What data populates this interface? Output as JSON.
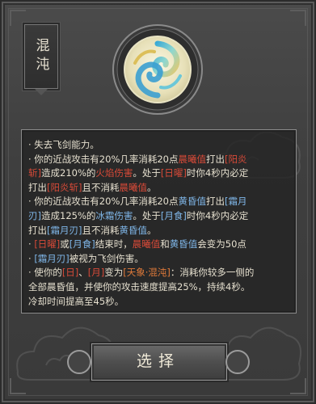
{
  "skill": {
    "name": "混沌",
    "lines": [
      {
        "parts": [
          {
            "t": "· 失去飞剑能力。",
            "c": ""
          }
        ]
      },
      {
        "parts": [
          {
            "t": "· 你的近战攻击有20%几率消耗20点",
            "c": ""
          },
          {
            "t": "晨曦值",
            "c": "r"
          },
          {
            "t": "打出",
            "c": ""
          },
          {
            "t": "[阳炎",
            "c": "r"
          }
        ]
      },
      {
        "parts": [
          {
            "t": "斩]",
            "c": "r"
          },
          {
            "t": "造成210%的",
            "c": ""
          },
          {
            "t": "火焰伤害",
            "c": "r"
          },
          {
            "t": "。处于",
            "c": ""
          },
          {
            "t": "[日曜]",
            "c": "r"
          },
          {
            "t": "时你4秒内必定",
            "c": ""
          }
        ]
      },
      {
        "parts": [
          {
            "t": "打出",
            "c": ""
          },
          {
            "t": "[阳炎斩]",
            "c": "r"
          },
          {
            "t": "且不消耗",
            "c": ""
          },
          {
            "t": "晨曦值",
            "c": "r"
          },
          {
            "t": "。",
            "c": ""
          }
        ]
      },
      {
        "parts": [
          {
            "t": "· 你的近战攻击有20%几率消耗20点",
            "c": ""
          },
          {
            "t": "黄昏值",
            "c": "b"
          },
          {
            "t": "打出",
            "c": ""
          },
          {
            "t": "[霜月",
            "c": "b"
          }
        ]
      },
      {
        "parts": [
          {
            "t": "刃]",
            "c": "b"
          },
          {
            "t": "造成125%的",
            "c": ""
          },
          {
            "t": "冰霜伤害",
            "c": "b"
          },
          {
            "t": "。处于",
            "c": ""
          },
          {
            "t": "[月食]",
            "c": "b"
          },
          {
            "t": "时你4秒内必定",
            "c": ""
          }
        ]
      },
      {
        "parts": [
          {
            "t": "打出",
            "c": ""
          },
          {
            "t": "[霜月刃]",
            "c": "b"
          },
          {
            "t": "且不消耗",
            "c": ""
          },
          {
            "t": "黄昏值",
            "c": "b"
          },
          {
            "t": "。",
            "c": ""
          }
        ]
      },
      {
        "parts": [
          {
            "t": "· ",
            "c": ""
          },
          {
            "t": "[日曜]",
            "c": "r"
          },
          {
            "t": "或",
            "c": ""
          },
          {
            "t": "[月食]",
            "c": "b"
          },
          {
            "t": "结束时，",
            "c": ""
          },
          {
            "t": "晨曦值",
            "c": "r"
          },
          {
            "t": "和",
            "c": ""
          },
          {
            "t": "黄昏值",
            "c": "b"
          },
          {
            "t": "会变为50点",
            "c": ""
          }
        ]
      },
      {
        "parts": [
          {
            "t": "· ",
            "c": ""
          },
          {
            "t": "[霜月刃]",
            "c": "b"
          },
          {
            "t": "被视为飞剑伤害。",
            "c": ""
          }
        ]
      },
      {
        "parts": [
          {
            "t": "· 使你的",
            "c": ""
          },
          {
            "t": "[日]",
            "c": "r"
          },
          {
            "t": "、",
            "c": ""
          },
          {
            "t": "[月]",
            "c": "r"
          },
          {
            "t": "变为",
            "c": ""
          },
          {
            "t": "[天象·混沌]",
            "c": "o"
          },
          {
            "t": "：消耗你较多一侧的",
            "c": ""
          }
        ]
      },
      {
        "parts": [
          {
            "t": "全部晨昏值，并使你的攻击速度提高25%，持续4秒。",
            "c": ""
          }
        ]
      },
      {
        "parts": [
          {
            "t": "冷却时间提高至45秒。",
            "c": ""
          }
        ]
      }
    ]
  },
  "button": {
    "label": "选择"
  },
  "icons": {
    "emblem": "swirl-emblem-icon"
  },
  "colors": {
    "red": "#d84a38",
    "blue": "#7fb6e8",
    "orange": "#e07a3a",
    "text": "#e6e0cf"
  }
}
